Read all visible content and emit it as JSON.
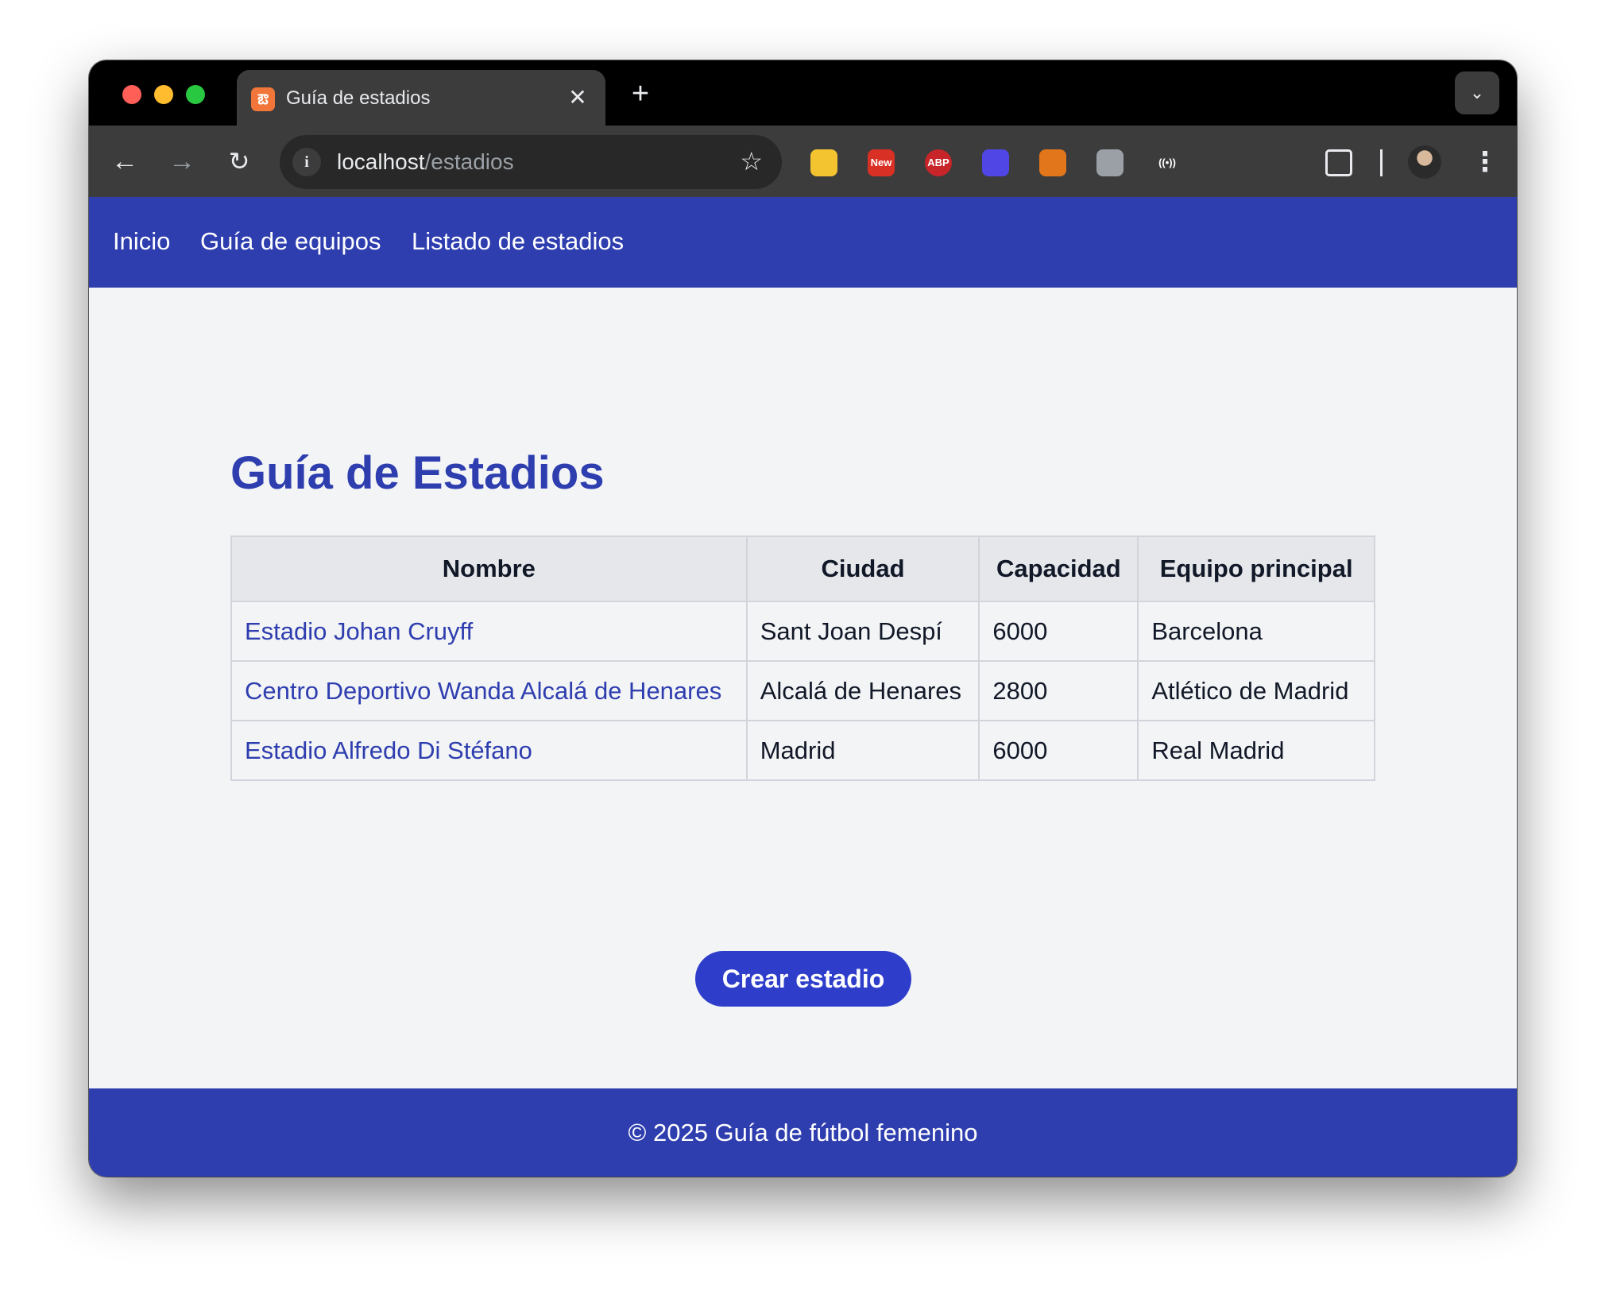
{
  "browser": {
    "tab_title": "Guía de estadios",
    "tab_close": "✕",
    "new_tab": "+",
    "tab_menu": "⌄",
    "url_host": "localhost",
    "url_path": "/estadios",
    "back": "←",
    "forward": "→",
    "reload": "↻",
    "info": "i",
    "star": "☆",
    "menu": "⋮",
    "extensions": [
      {
        "name": "keep-extension-icon",
        "label": "",
        "color": "#f4c430"
      },
      {
        "name": "new-badge-extension-icon",
        "label": "New",
        "color": "#d93025"
      },
      {
        "name": "abp-extension-icon",
        "label": "ABP",
        "color": "#c7252a"
      },
      {
        "name": "hexagon-extension-icon",
        "label": "",
        "color": "#4f46e5"
      },
      {
        "name": "metamask-extension-icon",
        "label": "",
        "color": "#e2761b"
      },
      {
        "name": "disabled-extension-icon",
        "label": "",
        "color": "#9aa0a6"
      },
      {
        "name": "broadcast-extension-icon",
        "label": "((•))",
        "color": "#3c3c3c"
      },
      {
        "name": "rocket-extension-icon",
        "label": "",
        "color": "#3c3c3c"
      },
      {
        "name": "tracker-block-extension-icon",
        "label": "",
        "color": "#3c3c3c"
      },
      {
        "name": "puzzle-extensions-icon",
        "label": "",
        "color": "#3c3c3c"
      }
    ]
  },
  "nav": {
    "items": [
      "Inicio",
      "Guía de equipos",
      "Listado de estadios"
    ]
  },
  "main": {
    "title": "Guía de Estadios",
    "table": {
      "headers": [
        "Nombre",
        "Ciudad",
        "Capacidad",
        "Equipo principal"
      ],
      "rows": [
        [
          "Estadio Johan Cruyff",
          "Sant Joan Despí",
          "6000",
          "Barcelona"
        ],
        [
          "Centro Deportivo Wanda Alcalá de Henares",
          "Alcalá de Henares",
          "2800",
          "Atlético de Madrid"
        ],
        [
          "Estadio Alfredo Di Stéfano",
          "Madrid",
          "6000",
          "Real Madrid"
        ]
      ]
    },
    "create_button": "Crear estadio"
  },
  "footer": {
    "text": "© 2025 Guía de fútbol femenino"
  },
  "colors": {
    "brand": "#2e3eaf",
    "button": "#2e3eca"
  }
}
